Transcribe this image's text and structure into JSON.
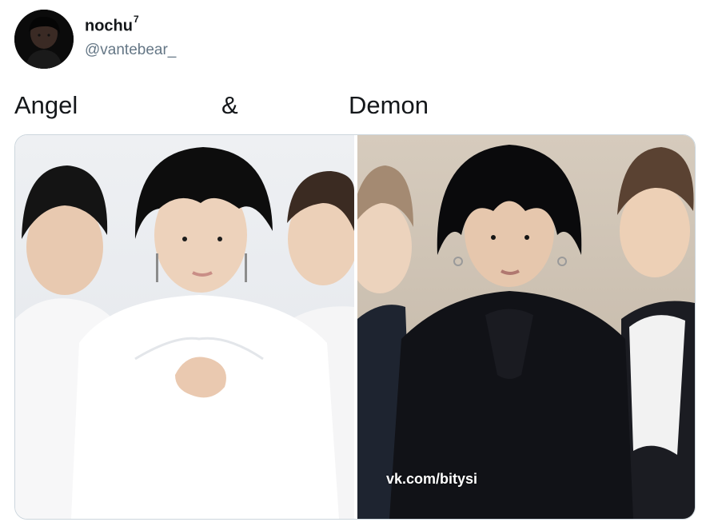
{
  "author": {
    "display_name": "nochu",
    "name_superscript": "7",
    "handle": "@vantebear_",
    "avatar_icon": "profile-photo"
  },
  "tweet": {
    "text_left": "Angel",
    "text_middle": "&",
    "text_right": "Demon"
  },
  "media": {
    "left_photo_icon": "photo-angel",
    "right_photo_icon": "photo-demon",
    "watermark": "vk.com/bitysi"
  },
  "colors": {
    "text_primary": "#14171a",
    "text_secondary": "#657786",
    "media_border": "#ccd6dd"
  }
}
